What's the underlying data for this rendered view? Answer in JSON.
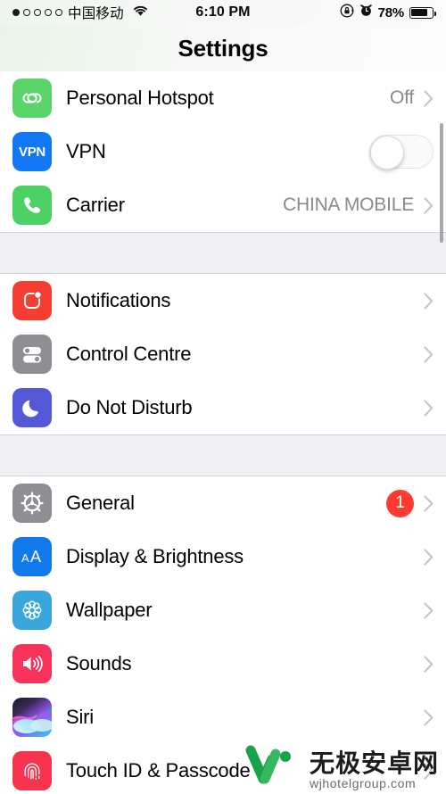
{
  "status_bar": {
    "signal_dots_total": 5,
    "signal_dots_filled": 1,
    "carrier": "中国移动",
    "wifi_icon": "wifi-icon",
    "time": "6:10 PM",
    "rotation_lock_icon": "rotation-lock-icon",
    "alarm_icon": "alarm-clock-icon",
    "battery_percent": "78%",
    "battery_level": 78
  },
  "nav": {
    "title": "Settings"
  },
  "colors": {
    "hotspot_green": "#5ad469",
    "vpn_blue": "#1277f2",
    "carrier_green": "#4cd264",
    "notifications_red": "#f63d32",
    "control_centre_gray": "#8e8e93",
    "dnd_indigo": "#5457d6",
    "general_gray": "#8e8e93",
    "display_blue": "#117aea",
    "wallpaper_blue": "#3aa7dc",
    "sounds_pink": "#f8335a",
    "siri_dark": "#2b2b3c",
    "touchid_red": "#f8334e",
    "badge_red": "#ff3b30",
    "group_background": "#efeff4",
    "value_gray": "#8a8a8e"
  },
  "groups": [
    {
      "rows": [
        {
          "label": "Personal Hotspot",
          "icon": "personal-hotspot-icon",
          "value": "Off",
          "accessory": "chevron",
          "badge": null
        },
        {
          "label": "VPN",
          "icon": "vpn-icon",
          "value": "",
          "accessory": "toggle",
          "toggle_on": false,
          "badge": null
        },
        {
          "label": "Carrier",
          "icon": "carrier-phone-icon",
          "value": "CHINA MOBILE",
          "accessory": "chevron",
          "badge": null
        }
      ]
    },
    {
      "rows": [
        {
          "label": "Notifications",
          "icon": "notifications-icon",
          "value": "",
          "accessory": "chevron",
          "badge": null
        },
        {
          "label": "Control Centre",
          "icon": "control-centre-icon",
          "value": "",
          "accessory": "chevron",
          "badge": null
        },
        {
          "label": "Do Not Disturb",
          "icon": "do-not-disturb-moon-icon",
          "value": "",
          "accessory": "chevron",
          "badge": null
        }
      ]
    },
    {
      "rows": [
        {
          "label": "General",
          "icon": "general-gear-icon",
          "value": "",
          "accessory": "chevron",
          "badge": "1"
        },
        {
          "label": "Display & Brightness",
          "icon": "display-brightness-icon",
          "value": "",
          "accessory": "chevron",
          "badge": null
        },
        {
          "label": "Wallpaper",
          "icon": "wallpaper-flower-icon",
          "value": "",
          "accessory": "chevron",
          "badge": null
        },
        {
          "label": "Sounds",
          "icon": "sounds-speaker-icon",
          "value": "",
          "accessory": "chevron",
          "badge": null
        },
        {
          "label": "Siri",
          "icon": "siri-icon",
          "value": "",
          "accessory": "chevron",
          "badge": null
        },
        {
          "label": "Touch ID & Passcode",
          "icon": "touch-id-fingerprint-icon",
          "value": "",
          "accessory": "chevron",
          "badge": null
        }
      ]
    }
  ],
  "watermark": {
    "logo_icon": "w-logo-icon",
    "site_name": "无极安卓网",
    "site_url": "wjhotelgroup.com"
  }
}
